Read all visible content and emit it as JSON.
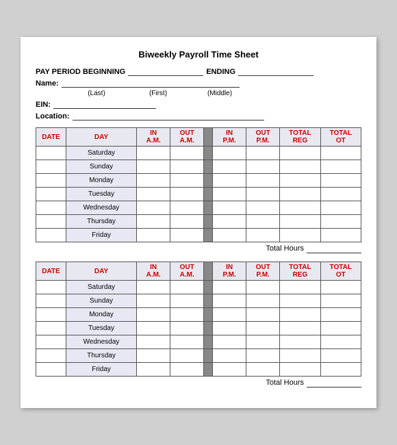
{
  "title": "Biweekly Payroll Time Sheet",
  "header": {
    "pay_period_label": "PAY PERIOD BEGINNING",
    "ending_label": "ENDING",
    "name_label": "Name:",
    "name_sublabels": [
      "(Last)",
      "(First)",
      "(Middle)"
    ],
    "ein_label": "EIN:",
    "location_label": "Location:"
  },
  "table": {
    "columns": [
      "DATE",
      "DAY",
      "IN A.M.",
      "OUT A.M.",
      "",
      "IN P.M.",
      "OUT P.M.",
      "TOTAL REG",
      "TOTAL OT"
    ],
    "days": [
      "Saturday",
      "Sunday",
      "Monday",
      "Tuesday",
      "Wednesday",
      "Thursday",
      "Friday"
    ],
    "total_hours_label": "Total Hours"
  },
  "colors": {
    "header_bg": "#e8e8f0",
    "day_bg": "#e8e8f4",
    "divider": "#888888",
    "red": "#cc0000"
  }
}
